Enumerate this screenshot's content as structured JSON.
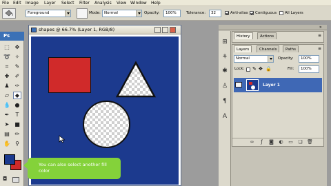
{
  "menu": [
    "File",
    "Edit",
    "Image",
    "Layer",
    "Select",
    "Filter",
    "Analysis",
    "View",
    "Window",
    "Help"
  ],
  "options": {
    "fill_source": "Foreground",
    "mode_label": "Mode:",
    "mode_value": "Normal",
    "opacity_label": "Opacity:",
    "opacity_value": "100%",
    "tolerance_label": "Tolerance:",
    "tolerance_value": "32",
    "anti_alias_label": "Anti-alias",
    "anti_alias_checked": true,
    "contiguous_label": "Contiguous",
    "contiguous_checked": true,
    "all_layers_label": "All Layers",
    "all_layers_checked": false
  },
  "toolbox": {
    "logo": "Ps",
    "foreground_color": "#1c3a8e",
    "background_color": "#d02a2a"
  },
  "document": {
    "title": "shapes @ 66.7% (Layer 1, RGB/8)",
    "canvas_color": "#1c3a8e",
    "rect_color": "#d02a2a"
  },
  "tooltip": {
    "text": "You can also select another fill color"
  },
  "panels": {
    "history_tabs": [
      "History",
      "Actions"
    ],
    "layers_tabs": [
      "Layers",
      "Channels",
      "Paths"
    ],
    "blend_mode": "Normal",
    "opacity_label": "Opacity:",
    "opacity_value": "100%",
    "lock_label": "Lock:",
    "fill_label": "Fill:",
    "fill_value": "100%",
    "layer_name": "Layer 1",
    "selected_layer_color": "#3f68b5"
  }
}
